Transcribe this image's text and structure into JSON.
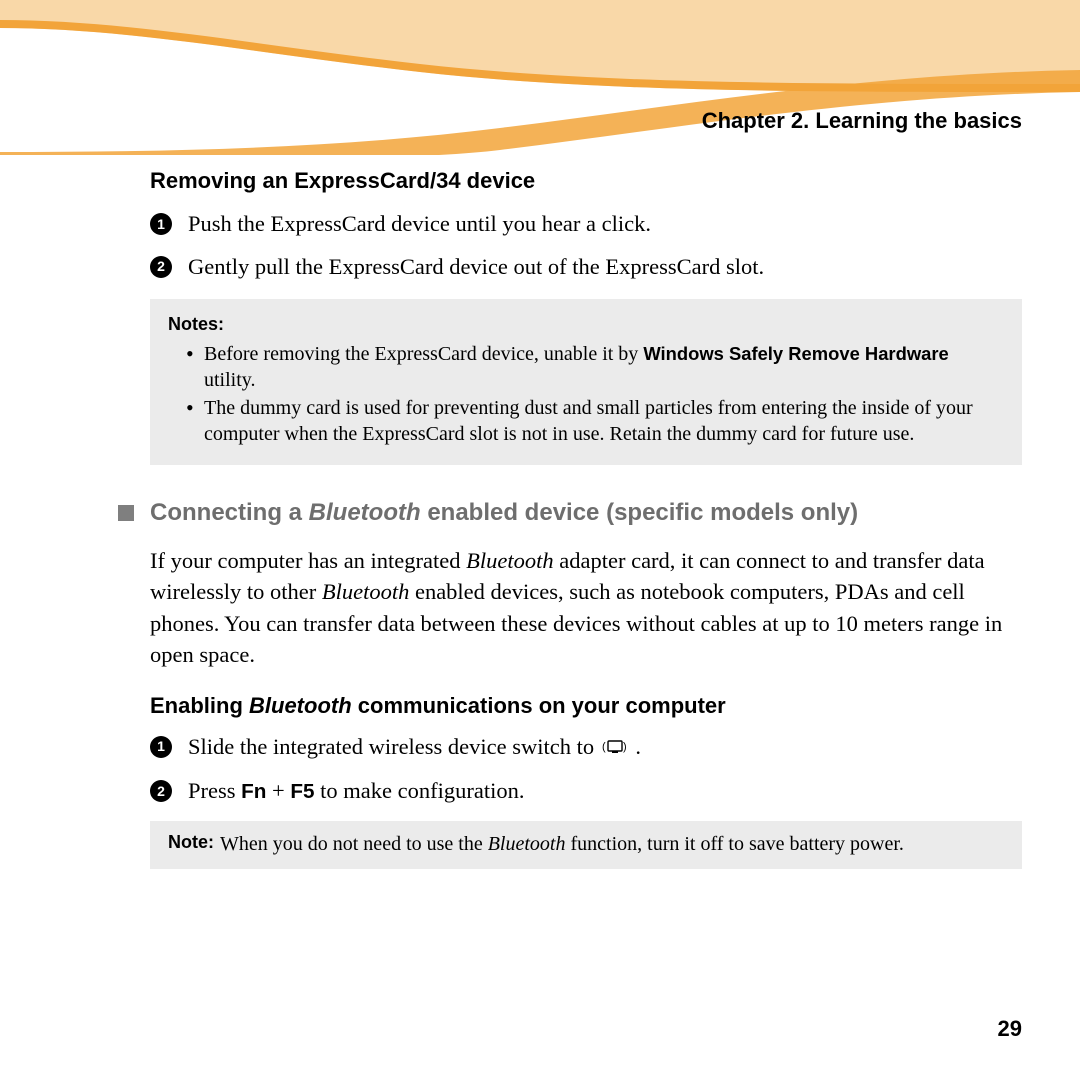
{
  "chapter": "Chapter 2. Learning the basics",
  "section1": {
    "heading": "Removing an ExpressCard/34 device",
    "step1": "Push the ExpressCard device until you hear a click.",
    "step2": "Gently pull the ExpressCard device out of the ExpressCard slot."
  },
  "notes": {
    "title": "Notes:",
    "item1_a": "Before removing the ExpressCard device, unable it by ",
    "item1_b": "Windows Safely Remove Hardware",
    "item1_c": " utility.",
    "item2": "The dummy card is used for preventing dust and small particles from entering the inside of your computer when the ExpressCard slot is not in use. Retain the dummy card for future use."
  },
  "section2": {
    "heading_a": "Connecting a ",
    "heading_b": "Bluetooth",
    "heading_c": " enabled device (specific models only)",
    "para_a": "If your computer has an integrated ",
    "para_b": "Bluetooth",
    "para_c": " adapter card, it can connect to and transfer data wirelessly to other ",
    "para_d": "Bluetooth",
    "para_e": " enabled devices, such as notebook computers, PDAs and cell phones. You can transfer data between these devices without cables at up to 10 meters range in open space."
  },
  "section3": {
    "heading_a": "Enabling ",
    "heading_b": "Bluetooth",
    "heading_c": " communications on your computer",
    "step1": "Slide the integrated wireless device switch to ",
    "step2_a": "Press ",
    "step2_b": "Fn",
    "step2_c": " + ",
    "step2_d": "F5",
    "step2_e": " to make configuration."
  },
  "note2": {
    "label": "Note:",
    "text_a": " When you do not need to use the ",
    "text_b": "Bluetooth",
    "text_c": " function, turn it off to save battery power."
  },
  "page": "29"
}
